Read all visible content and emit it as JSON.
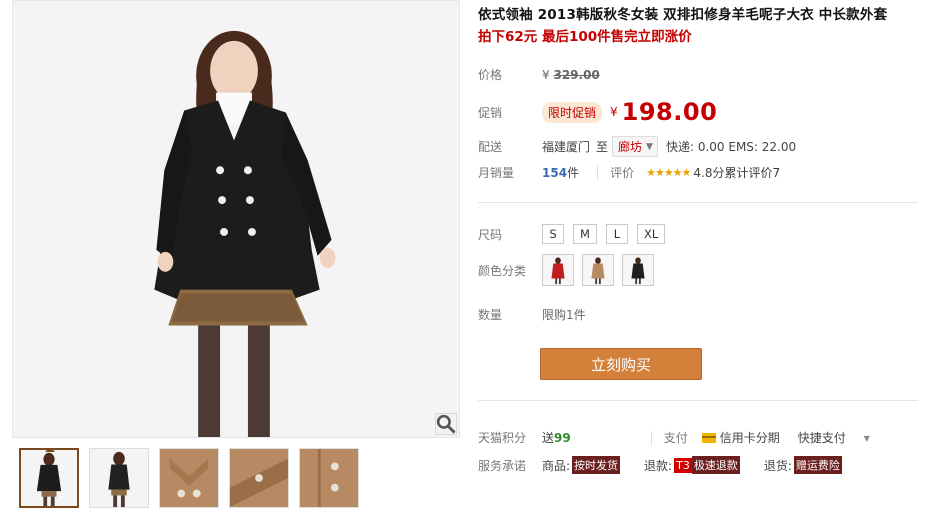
{
  "product": {
    "title": "依式领袖 2013韩版秋冬女装 双排扣修身羊毛呢子大衣 中长款外套",
    "subtitle": "拍下62元 最后100件售完立即涨价"
  },
  "price": {
    "label": "价格",
    "currency": "¥",
    "original": "329.00"
  },
  "promo": {
    "label": "促销",
    "tag": "限时促销",
    "currency": "¥",
    "price": "198.00"
  },
  "shipping": {
    "label": "配送",
    "origin": "福建厦门",
    "to": "至",
    "destination": "廊坊",
    "fees": "快递: 0.00 EMS: 22.00"
  },
  "sales": {
    "label": "月销量",
    "count": "154",
    "unit": "件",
    "review_label": "评价",
    "stars": "★★★★★",
    "score": "4.8分",
    "review_count": "累计评价7"
  },
  "size": {
    "label": "尺码",
    "options": [
      "S",
      "M",
      "L",
      "XL"
    ]
  },
  "color": {
    "label": "颜色分类",
    "swatches": [
      "#c21d1d",
      "#b88a63",
      "#1f1f1f"
    ]
  },
  "quantity": {
    "label": "数量",
    "limit": "限购1件"
  },
  "buy_button": "立刻购买",
  "points": {
    "label": "天猫积分",
    "prefix": "送",
    "value": "99",
    "pay_label": "支付",
    "installment": "信用卡分期",
    "quick_pay": "快捷支付",
    "more": "▾"
  },
  "service": {
    "label": "服务承诺",
    "goods_label": "商品:",
    "goods_badge": "按时发货",
    "refund_label": "退款:",
    "refund_icon": "T3",
    "refund_badge": "极速退款",
    "return_label": "退货:",
    "return_badge": "赠运费险"
  },
  "colors": {
    "accent_red": "#c40000",
    "buy_button": "#d3803b",
    "coat_black": "#1c1c1c",
    "coat_camel": "#b88a63"
  }
}
